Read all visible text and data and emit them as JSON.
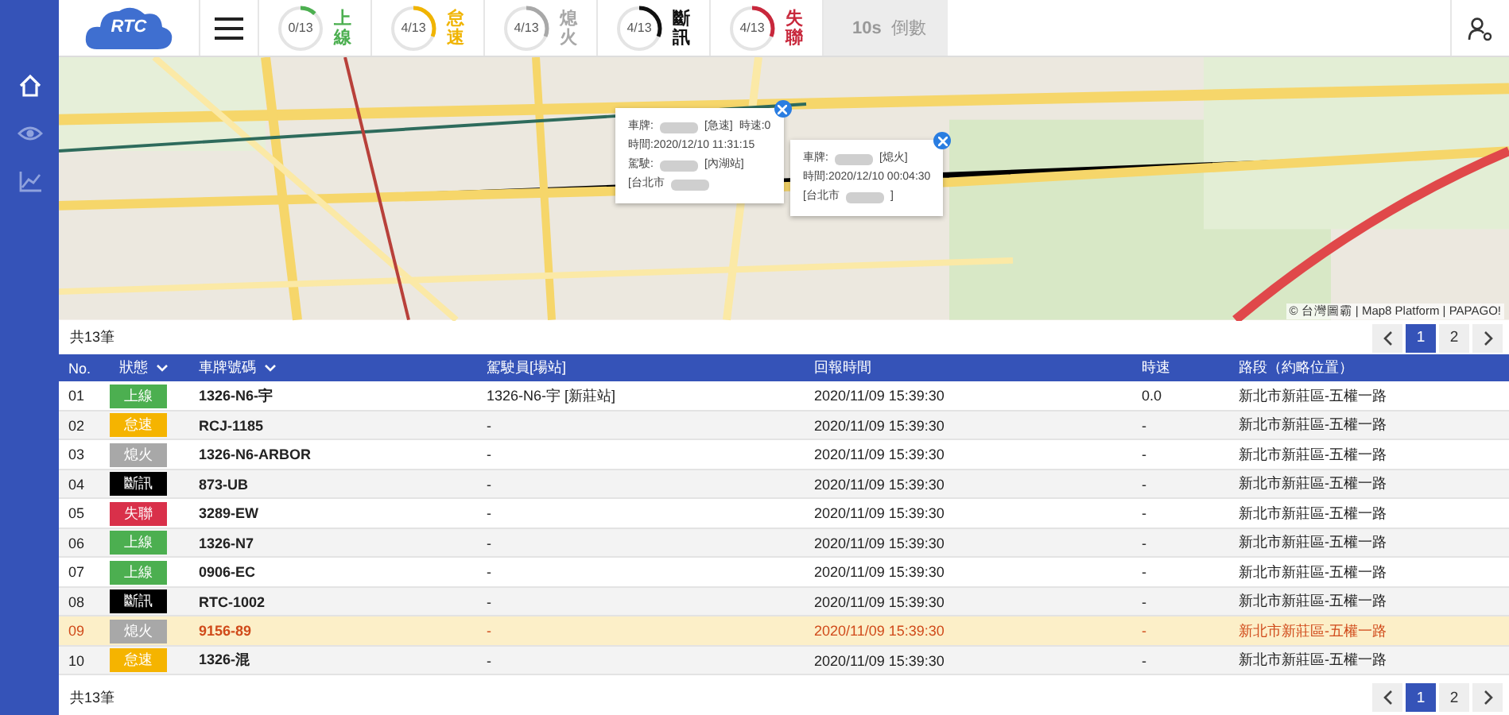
{
  "header": {
    "logo_text": "RTC",
    "gauges": [
      {
        "count": "0/13",
        "label": "上線",
        "color": "#4caf50",
        "level": 0.12
      },
      {
        "count": "4/13",
        "label": "怠速",
        "color": "#f0b400",
        "level": 0.31
      },
      {
        "count": "4/13",
        "label": "熄火",
        "color": "#a8a8a8",
        "level": 0.31
      },
      {
        "count": "4/13",
        "label": "斷訊",
        "color": "#111111",
        "level": 0.31
      },
      {
        "count": "4/13",
        "label": "失聯",
        "color": "#c8283c",
        "level": 0.31
      }
    ],
    "countdown": {
      "value": "10s",
      "label": "倒數"
    }
  },
  "sidebar": {
    "items": [
      {
        "selected": true
      },
      {
        "selected": false
      },
      {
        "selected": false
      }
    ]
  },
  "map": {
    "popups": [
      {
        "lines": [
          [
            {
              "kind": "text",
              "text": "車牌:"
            },
            {
              "kind": "redacted"
            },
            {
              "kind": "text",
              "text": "[急速]"
            },
            {
              "kind": "text",
              "text": "時速:0"
            }
          ],
          [
            {
              "kind": "text",
              "text": "時間:2020/12/10 11:31:15"
            }
          ],
          [
            {
              "kind": "text",
              "text": "駕駛:"
            },
            {
              "kind": "redacted"
            },
            {
              "kind": "text",
              "text": "[內湖站]"
            }
          ],
          [
            {
              "kind": "text",
              "text": "[台北市"
            },
            {
              "kind": "redacted"
            }
          ]
        ]
      },
      {
        "lines": [
          [
            {
              "kind": "text",
              "text": "車牌:"
            },
            {
              "kind": "redacted"
            },
            {
              "kind": "text",
              "text": "[熄火]"
            }
          ],
          [
            {
              "kind": "text",
              "text": "時間:2020/12/10 00:04:30"
            }
          ],
          [
            {
              "kind": "text",
              "text": "[台北市"
            },
            {
              "kind": "redacted"
            },
            {
              "kind": "text",
              "text": "]"
            }
          ]
        ]
      }
    ],
    "attribution": "© 台灣圖霸 | Map8 Platform | PAPAGO!"
  },
  "total_top": "共13筆",
  "pagination_top": {
    "pages": [
      {
        "label": "1",
        "selected": true
      },
      {
        "label": "2",
        "selected": false
      }
    ]
  },
  "table": {
    "columns": [
      "No.",
      "狀態",
      "車牌號碼",
      "駕駛員[場站]",
      "回報時間",
      "時速",
      "路段（約略位置）"
    ],
    "rows": [
      {
        "no": "01",
        "status": "上線",
        "color": "#4caf50",
        "plate": "1326-N6-宇",
        "driver": "1326-N6-宇 [新莊站]",
        "time": "2020/11/09 15:39:30",
        "speed": "0.0",
        "road": "新北市新莊區-五權一路",
        "selected": false
      },
      {
        "no": "02",
        "status": "怠速",
        "color": "#f5b400",
        "plate": "RCJ-1185",
        "driver": "-",
        "time": "2020/11/09 15:39:30",
        "speed": "-",
        "road": "新北市新莊區-五權一路",
        "selected": false
      },
      {
        "no": "03",
        "status": "熄火",
        "color": "#a8a8a8",
        "plate": "1326-N6-ARBOR",
        "driver": "-",
        "time": "2020/11/09 15:39:30",
        "speed": "-",
        "road": "新北市新莊區-五權一路",
        "selected": false
      },
      {
        "no": "04",
        "status": "斷訊",
        "color": "#000000",
        "plate": "873-UB",
        "driver": "-",
        "time": "2020/11/09 15:39:30",
        "speed": "-",
        "road": "新北市新莊區-五權一路",
        "selected": false
      },
      {
        "no": "05",
        "status": "失聯",
        "color": "#d9304a",
        "plate": "3289-EW",
        "driver": "-",
        "time": "2020/11/09 15:39:30",
        "speed": "-",
        "road": "新北市新莊區-五權一路",
        "selected": false
      },
      {
        "no": "06",
        "status": "上線",
        "color": "#4caf50",
        "plate": "1326-N7",
        "driver": "-",
        "time": "2020/11/09 15:39:30",
        "speed": "-",
        "road": "新北市新莊區-五權一路",
        "selected": false
      },
      {
        "no": "07",
        "status": "上線",
        "color": "#4caf50",
        "plate": "0906-EC",
        "driver": "-",
        "time": "2020/11/09 15:39:30",
        "speed": "-",
        "road": "新北市新莊區-五權一路",
        "selected": false
      },
      {
        "no": "08",
        "status": "斷訊",
        "color": "#000000",
        "plate": "RTC-1002",
        "driver": "-",
        "time": "2020/11/09 15:39:30",
        "speed": "-",
        "road": "新北市新莊區-五權一路",
        "selected": false
      },
      {
        "no": "09",
        "status": "熄火",
        "color": "#a8a8a8",
        "plate": "9156-89",
        "driver": "-",
        "time": "2020/11/09 15:39:30",
        "speed": "-",
        "road": "新北市新莊區-五權一路",
        "selected": true
      },
      {
        "no": "10",
        "status": "怠速",
        "color": "#f5b400",
        "plate": "1326-混",
        "driver": "-",
        "time": "2020/11/09 15:39:30",
        "speed": "-",
        "road": "新北市新莊區-五權一路",
        "selected": false
      }
    ]
  },
  "total_bottom": "共13筆",
  "pagination_bottom": {
    "pages": [
      {
        "label": "1",
        "selected": true
      },
      {
        "label": "2",
        "selected": false
      }
    ]
  }
}
